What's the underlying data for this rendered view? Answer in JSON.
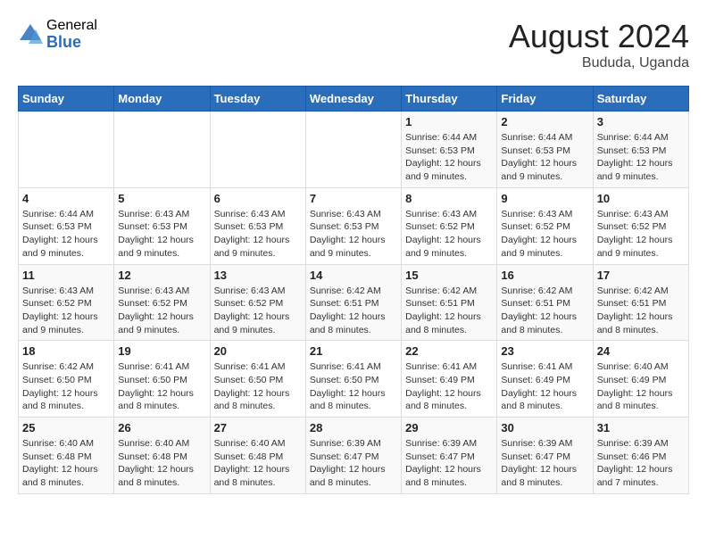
{
  "logo": {
    "general": "General",
    "blue": "Blue"
  },
  "title": {
    "month_year": "August 2024",
    "location": "Bududa, Uganda"
  },
  "days_of_week": [
    "Sunday",
    "Monday",
    "Tuesday",
    "Wednesday",
    "Thursday",
    "Friday",
    "Saturday"
  ],
  "weeks": [
    [
      {
        "day": "",
        "info": ""
      },
      {
        "day": "",
        "info": ""
      },
      {
        "day": "",
        "info": ""
      },
      {
        "day": "",
        "info": ""
      },
      {
        "day": "1",
        "info": "Sunrise: 6:44 AM\nSunset: 6:53 PM\nDaylight: 12 hours\nand 9 minutes."
      },
      {
        "day": "2",
        "info": "Sunrise: 6:44 AM\nSunset: 6:53 PM\nDaylight: 12 hours\nand 9 minutes."
      },
      {
        "day": "3",
        "info": "Sunrise: 6:44 AM\nSunset: 6:53 PM\nDaylight: 12 hours\nand 9 minutes."
      }
    ],
    [
      {
        "day": "4",
        "info": "Sunrise: 6:44 AM\nSunset: 6:53 PM\nDaylight: 12 hours\nand 9 minutes."
      },
      {
        "day": "5",
        "info": "Sunrise: 6:43 AM\nSunset: 6:53 PM\nDaylight: 12 hours\nand 9 minutes."
      },
      {
        "day": "6",
        "info": "Sunrise: 6:43 AM\nSunset: 6:53 PM\nDaylight: 12 hours\nand 9 minutes."
      },
      {
        "day": "7",
        "info": "Sunrise: 6:43 AM\nSunset: 6:53 PM\nDaylight: 12 hours\nand 9 minutes."
      },
      {
        "day": "8",
        "info": "Sunrise: 6:43 AM\nSunset: 6:52 PM\nDaylight: 12 hours\nand 9 minutes."
      },
      {
        "day": "9",
        "info": "Sunrise: 6:43 AM\nSunset: 6:52 PM\nDaylight: 12 hours\nand 9 minutes."
      },
      {
        "day": "10",
        "info": "Sunrise: 6:43 AM\nSunset: 6:52 PM\nDaylight: 12 hours\nand 9 minutes."
      }
    ],
    [
      {
        "day": "11",
        "info": "Sunrise: 6:43 AM\nSunset: 6:52 PM\nDaylight: 12 hours\nand 9 minutes."
      },
      {
        "day": "12",
        "info": "Sunrise: 6:43 AM\nSunset: 6:52 PM\nDaylight: 12 hours\nand 9 minutes."
      },
      {
        "day": "13",
        "info": "Sunrise: 6:43 AM\nSunset: 6:52 PM\nDaylight: 12 hours\nand 9 minutes."
      },
      {
        "day": "14",
        "info": "Sunrise: 6:42 AM\nSunset: 6:51 PM\nDaylight: 12 hours\nand 8 minutes."
      },
      {
        "day": "15",
        "info": "Sunrise: 6:42 AM\nSunset: 6:51 PM\nDaylight: 12 hours\nand 8 minutes."
      },
      {
        "day": "16",
        "info": "Sunrise: 6:42 AM\nSunset: 6:51 PM\nDaylight: 12 hours\nand 8 minutes."
      },
      {
        "day": "17",
        "info": "Sunrise: 6:42 AM\nSunset: 6:51 PM\nDaylight: 12 hours\nand 8 minutes."
      }
    ],
    [
      {
        "day": "18",
        "info": "Sunrise: 6:42 AM\nSunset: 6:50 PM\nDaylight: 12 hours\nand 8 minutes."
      },
      {
        "day": "19",
        "info": "Sunrise: 6:41 AM\nSunset: 6:50 PM\nDaylight: 12 hours\nand 8 minutes."
      },
      {
        "day": "20",
        "info": "Sunrise: 6:41 AM\nSunset: 6:50 PM\nDaylight: 12 hours\nand 8 minutes."
      },
      {
        "day": "21",
        "info": "Sunrise: 6:41 AM\nSunset: 6:50 PM\nDaylight: 12 hours\nand 8 minutes."
      },
      {
        "day": "22",
        "info": "Sunrise: 6:41 AM\nSunset: 6:49 PM\nDaylight: 12 hours\nand 8 minutes."
      },
      {
        "day": "23",
        "info": "Sunrise: 6:41 AM\nSunset: 6:49 PM\nDaylight: 12 hours\nand 8 minutes."
      },
      {
        "day": "24",
        "info": "Sunrise: 6:40 AM\nSunset: 6:49 PM\nDaylight: 12 hours\nand 8 minutes."
      }
    ],
    [
      {
        "day": "25",
        "info": "Sunrise: 6:40 AM\nSunset: 6:48 PM\nDaylight: 12 hours\nand 8 minutes."
      },
      {
        "day": "26",
        "info": "Sunrise: 6:40 AM\nSunset: 6:48 PM\nDaylight: 12 hours\nand 8 minutes."
      },
      {
        "day": "27",
        "info": "Sunrise: 6:40 AM\nSunset: 6:48 PM\nDaylight: 12 hours\nand 8 minutes."
      },
      {
        "day": "28",
        "info": "Sunrise: 6:39 AM\nSunset: 6:47 PM\nDaylight: 12 hours\nand 8 minutes."
      },
      {
        "day": "29",
        "info": "Sunrise: 6:39 AM\nSunset: 6:47 PM\nDaylight: 12 hours\nand 8 minutes."
      },
      {
        "day": "30",
        "info": "Sunrise: 6:39 AM\nSunset: 6:47 PM\nDaylight: 12 hours\nand 8 minutes."
      },
      {
        "day": "31",
        "info": "Sunrise: 6:39 AM\nSunset: 6:46 PM\nDaylight: 12 hours\nand 7 minutes."
      }
    ]
  ]
}
